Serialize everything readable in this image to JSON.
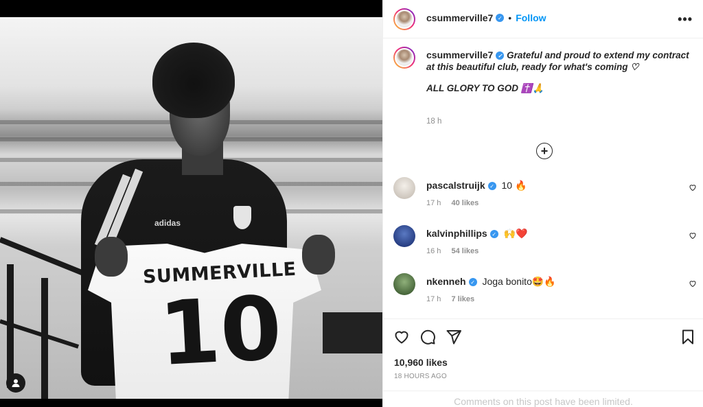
{
  "post": {
    "username": "csummerville7",
    "follow_label": "Follow",
    "more_label": "•••",
    "caption_line1": "Grateful and proud to extend my contract at this beautiful club, ready for what's coming ♡",
    "caption_line2": "ALL GLORY TO GOD ✝️🙏",
    "caption_time": "18 h",
    "likes": "10,960 likes",
    "date": "18 HOURS AGO",
    "comments_limited": "Comments on this post have been limited."
  },
  "photo": {
    "shirt_name": "SUMMERVILLE",
    "shirt_number": "10",
    "kit_brand": "adidas"
  },
  "comments": [
    {
      "user": "pascalstruijk",
      "text": "10 🔥",
      "time": "17 h",
      "likes": "40 likes",
      "avatar_color": "#d9d4cf"
    },
    {
      "user": "kalvinphillips",
      "text": "🙌❤️",
      "time": "16 h",
      "likes": "54 likes",
      "avatar_color": "#1f3f8a"
    },
    {
      "user": "nkenneh",
      "text": "Joga bonito🤩🔥",
      "time": "17 h",
      "likes": "7 likes",
      "avatar_color": "#3e6b2e"
    }
  ],
  "icons": {
    "like": "heart-icon",
    "comment": "comment-icon",
    "share": "send-icon",
    "save": "bookmark-icon",
    "more": "more-options-icon",
    "load": "plus-circle-icon",
    "tag": "user-tag-icon"
  },
  "colors": {
    "accent": "#0095f6",
    "verified": "#3897f0",
    "muted": "#8e8e8e"
  }
}
